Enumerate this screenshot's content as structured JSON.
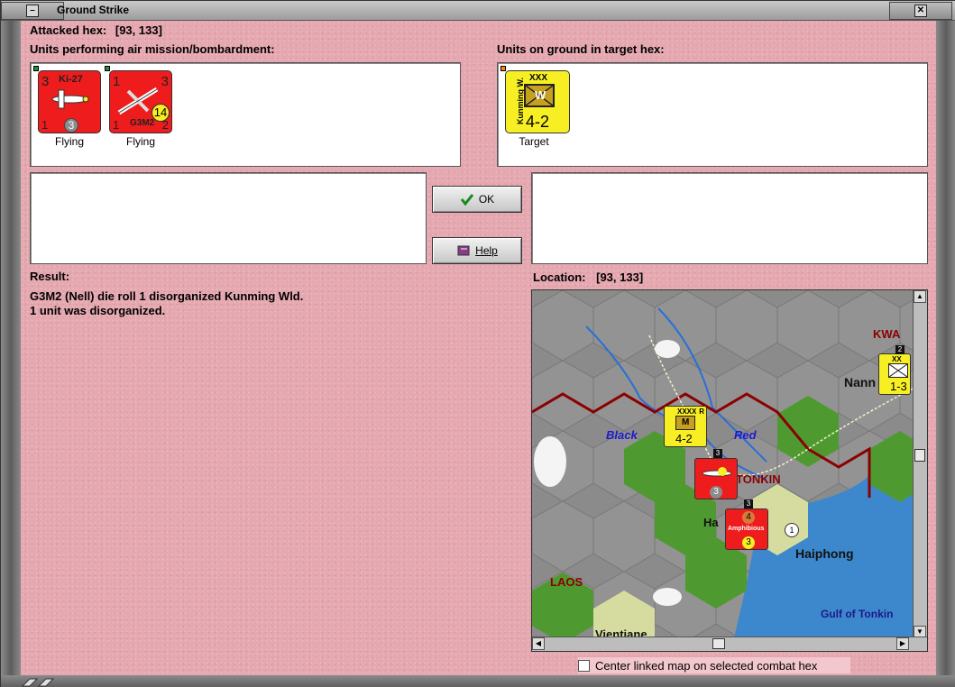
{
  "window": {
    "title": "Ground Strike"
  },
  "attacked_hex": {
    "label": "Attacked hex:",
    "value": "[93, 133]"
  },
  "air_units": {
    "label": "Units performing air mission/bombardment:",
    "units": [
      {
        "name": "Ki-27",
        "top_left": "3",
        "bottom_left": "1",
        "center": "3",
        "status": "Flying"
      },
      {
        "name": "G3M2",
        "top_left": "1",
        "top_right": "3",
        "bottom_left": "1",
        "bottom_right": "2",
        "center": "14",
        "status": "Flying"
      }
    ]
  },
  "ground_units": {
    "label": "Units on ground in target hex:",
    "units": [
      {
        "name": "Kunming W.",
        "size": "XXX",
        "type": "W",
        "strength": "4-2",
        "status": "Target"
      }
    ]
  },
  "buttons": {
    "ok": "OK",
    "help": "Help"
  },
  "result": {
    "label": "Result:",
    "lines": [
      "G3M2 (Nell) die roll 1 disorganized Kunming Wld.",
      "1 unit was disorganized."
    ]
  },
  "location": {
    "label": "Location:",
    "value": "[93, 133]"
  },
  "map": {
    "labels": {
      "black": "Black",
      "red": "Red",
      "tonkin": "TONKIN",
      "ha": "Ha",
      "haiphong": "Haiphong",
      "laos": "LAOS",
      "gulf": "Gulf of Tonkin",
      "vientiane": "Vientiane",
      "kwa": "KWA",
      "nann": "Nann"
    },
    "counters": {
      "c1_size": "XXXX",
      "c1_type": "M",
      "c1_strength": "4-2",
      "c1_flag": "R",
      "c2_size": "XX",
      "c2_strength": "1-3",
      "c2_stack": "2",
      "c3_stack": "3",
      "c3_center": "3",
      "c4_stack": "3",
      "c4_label": "Amphibious",
      "c4_top": "4",
      "c4_center": "3",
      "c5": "1"
    }
  },
  "center_option": {
    "label": "Center linked map on selected combat hex",
    "checked": false
  },
  "colors": {
    "background": "#e5a8b0",
    "unit_red": "#ee1c1c",
    "unit_yellow": "#f7ef23",
    "map_sea": "#3d88cc",
    "map_forest": "#4f9a30",
    "border_red": "#8b0000"
  }
}
